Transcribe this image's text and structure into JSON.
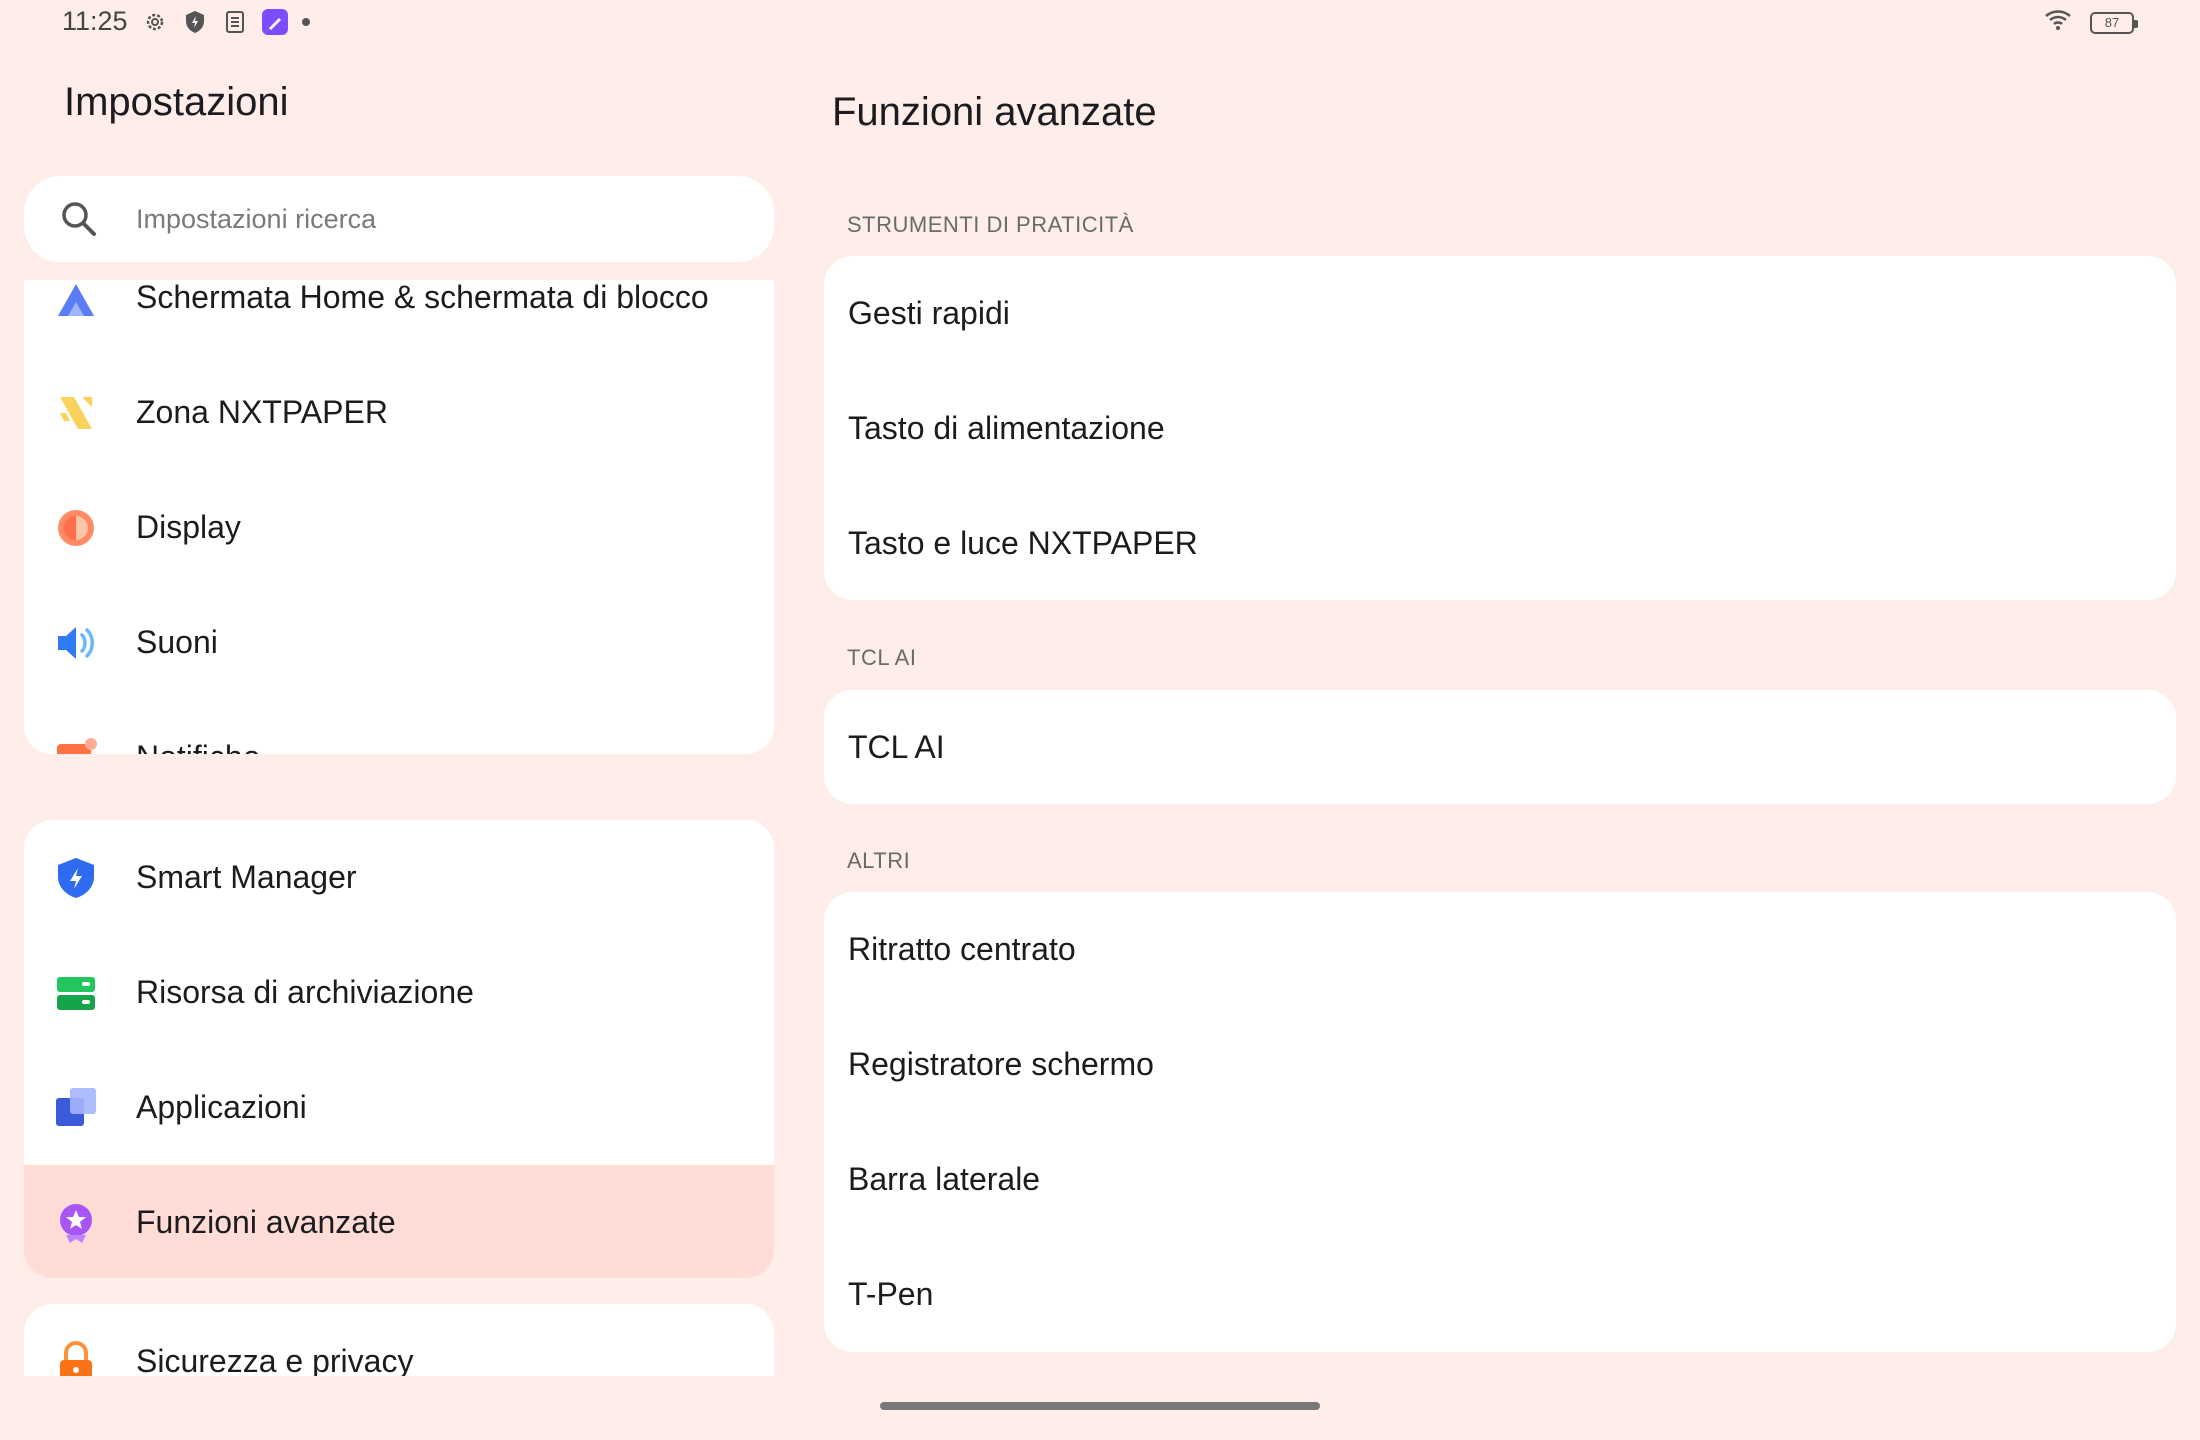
{
  "status_bar": {
    "time": "11:25",
    "battery": "87",
    "icons": [
      "settings-gear-icon",
      "shield-icon",
      "clipboard-icon",
      "app-pen-icon",
      "dot-icon",
      "wifi-icon",
      "battery-icon"
    ]
  },
  "left": {
    "title": "Impostazioni",
    "search_placeholder": "Impostazioni ricerca",
    "group1": [
      {
        "label": "Schermata Home & schermata di blocco",
        "icon": "home-lock-icon"
      },
      {
        "label": "Zona NXTPAPER",
        "icon": "nxtpaper-icon"
      },
      {
        "label": "Display",
        "icon": "display-icon"
      },
      {
        "label": "Suoni",
        "icon": "sound-icon"
      },
      {
        "label": "Notifiche",
        "icon": "notification-icon"
      }
    ],
    "group2": [
      {
        "label": "Smart Manager",
        "icon": "smart-manager-icon"
      },
      {
        "label": "Risorsa di archiviazione",
        "icon": "storage-icon"
      },
      {
        "label": "Applicazioni",
        "icon": "apps-icon"
      },
      {
        "label": "Funzioni avanzate",
        "icon": "advanced-features-icon",
        "selected": true
      }
    ],
    "group3": [
      {
        "label": "Sicurezza e privacy",
        "icon": "lock-icon"
      }
    ]
  },
  "right": {
    "title": "Funzioni avanzate",
    "sections": [
      {
        "header": "STRUMENTI DI PRATICITÀ",
        "items": [
          "Gesti rapidi",
          "Tasto di alimentazione",
          "Tasto e luce NXTPAPER"
        ]
      },
      {
        "header": "TCL AI",
        "items": [
          "TCL AI"
        ]
      },
      {
        "header": "ALTRI",
        "items": [
          "Ritratto centrato",
          "Registratore schermo",
          "Barra laterale",
          "T-Pen"
        ]
      }
    ]
  },
  "colors": {
    "background": "#FFEDE9",
    "card": "#FFFFFF",
    "selected": "#FFDCD6"
  }
}
